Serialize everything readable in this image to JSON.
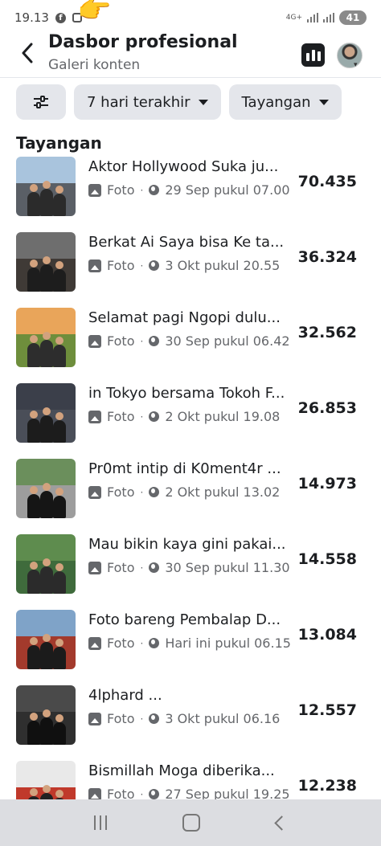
{
  "status_bar": {
    "time": "19.13",
    "network": "4G+",
    "battery": "41"
  },
  "header": {
    "title": "Dasbor profesional",
    "subtitle": "Galeri konten"
  },
  "filters": {
    "date_range": "7 hari terakhir",
    "metric": "Tayangan"
  },
  "section_title": "Tayangan",
  "posts": [
    {
      "title": "Aktor Hollywood Suka ju...",
      "type": "Foto",
      "time": "29 Sep pukul 07.00",
      "views": "70.435"
    },
    {
      "title": "Berkat Ai Saya bisa Ke ta...",
      "type": "Foto",
      "time": "3 Okt pukul 20.55",
      "views": "36.324"
    },
    {
      "title": "Selamat pagi Ngopi dulu...",
      "type": "Foto",
      "time": "30 Sep pukul 06.42",
      "views": "32.562"
    },
    {
      "title": "in Tokyo bersama Tokoh F...",
      "type": "Foto",
      "time": "2 Okt pukul 19.08",
      "views": "26.853"
    },
    {
      "title": "Pr0mt intip di K0ment4r ...",
      "type": "Foto",
      "time": "2 Okt pukul 13.02",
      "views": "14.973"
    },
    {
      "title": "Mau bikin kaya gini pakai...",
      "type": "Foto",
      "time": "30 Sep pukul 11.30",
      "views": "14.558"
    },
    {
      "title": "Foto bareng Pembalap D...",
      "type": "Foto",
      "time": "Hari ini pukul 06.15",
      "views": "13.084"
    },
    {
      "title": "4lphard ...",
      "type": "Foto",
      "time": "3 Okt pukul 06.16",
      "views": "12.557"
    },
    {
      "title": "Bismillah Moga diberika...",
      "type": "Foto",
      "time": "27 Sep pukul 19.25",
      "views": "12.238"
    }
  ],
  "icons": {
    "back": "arrow-left-icon",
    "insights": "bar-chart-icon",
    "filter": "sliders-icon",
    "photo": "photo-icon",
    "public": "globe-icon"
  }
}
